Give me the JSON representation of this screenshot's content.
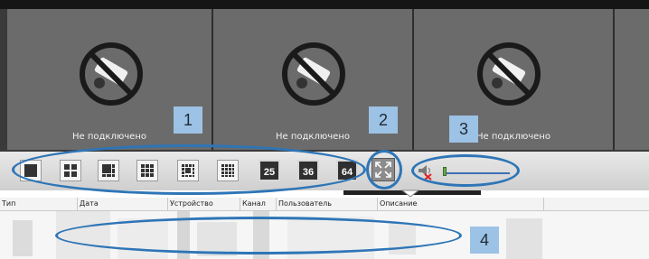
{
  "cameras": [
    {
      "status": "Не подключено"
    },
    {
      "status": "Не подключено"
    },
    {
      "status": "Не подключено"
    }
  ],
  "annotations": {
    "badge1": "1",
    "badge2": "2",
    "badge3": "3",
    "badge4": "4",
    "color": "#2e75b6",
    "badge_color": "#9cc2e5"
  },
  "toolbar": {
    "layouts": [
      "1x1",
      "2x2",
      "1+5",
      "3x3",
      "1+12",
      "4x4"
    ],
    "grid25_label": "25",
    "grid36_label": "36",
    "grid64_label": "64",
    "fullscreen_icon": "fullscreen-icon",
    "volume_icon": "speaker-muted-icon"
  },
  "table": {
    "columns": [
      "Тип",
      "Дата",
      "Устройство",
      "Канал",
      "Пользователь",
      "Описание"
    ]
  }
}
